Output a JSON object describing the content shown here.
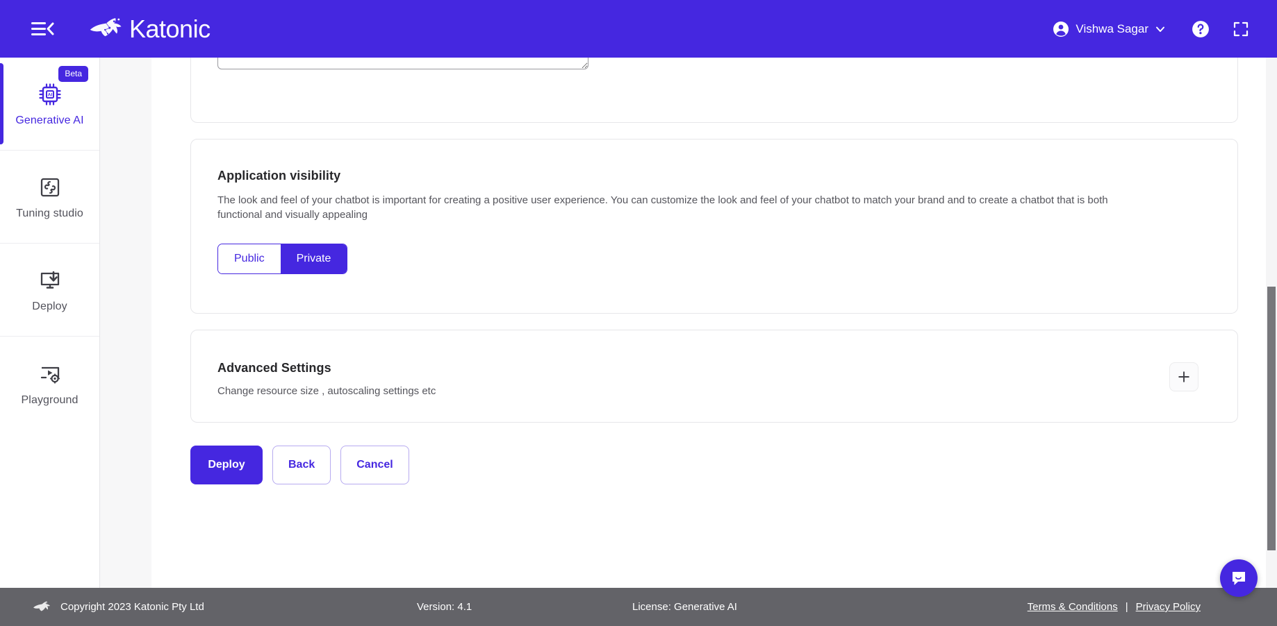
{
  "header": {
    "menu_icon": "menu-collapse-icon",
    "brand_name": "Katonic",
    "brand_logo_icon": "kangaroo-logo-icon",
    "user_name": "Vishwa Sagar",
    "user_avatar_icon": "user-avatar-icon",
    "user_chevron_icon": "chevron-down-icon",
    "help_icon": "help-circle-icon",
    "fullscreen_icon": "fullscreen-expand-icon",
    "accent_color": "#4527E0"
  },
  "sidebar": {
    "items": [
      {
        "label": "Generative AI",
        "icon": "ai-chip-icon",
        "badge": "Beta",
        "active": true
      },
      {
        "label": "Tuning studio",
        "icon": "puzzle-icon",
        "badge": null,
        "active": false
      },
      {
        "label": "Deploy",
        "icon": "monitor-download-icon",
        "badge": null,
        "active": false
      },
      {
        "label": "Playground",
        "icon": "screen-play-gear-icon",
        "badge": null,
        "active": false
      }
    ]
  },
  "main": {
    "description_field": {
      "value": "",
      "placeholder": ""
    },
    "visibility_card": {
      "title": "Application visibility",
      "description": "The look and feel of your chatbot is important for creating a positive user experience. You can customize the look and feel of your chatbot to match your brand and to create a chatbot that is both functional and visually appealing",
      "options": [
        "Public",
        "Private"
      ],
      "selected": "Private"
    },
    "advanced_card": {
      "title": "Advanced Settings",
      "description": "Change resource size , autoscaling settings etc",
      "expand_icon": "plus-icon"
    },
    "actions": [
      {
        "label": "Deploy",
        "style": "primary"
      },
      {
        "label": "Back",
        "style": "outline"
      },
      {
        "label": "Cancel",
        "style": "outline"
      }
    ]
  },
  "footer": {
    "logo_icon": "kangaroo-logo-icon",
    "copyright": "Copyright 2023 Katonic Pty Ltd",
    "version": "Version: 4.1",
    "license": "License: Generative AI",
    "terms_label": "Terms & Conditions",
    "separator": "|",
    "privacy_label": "Privacy Policy"
  },
  "chat_widget": {
    "icon": "chat-bubble-smile-icon"
  }
}
